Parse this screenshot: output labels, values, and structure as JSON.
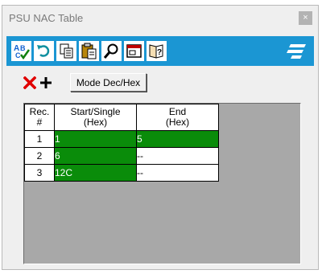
{
  "window": {
    "title": "PSU NAC Table",
    "close_glyph": "×"
  },
  "toolbar": {
    "buttons": [
      {
        "name": "spellcheck-icon"
      },
      {
        "name": "undo-icon"
      },
      {
        "name": "copy-icon"
      },
      {
        "name": "paste-icon"
      },
      {
        "name": "search-icon"
      },
      {
        "name": "window-icon"
      },
      {
        "name": "help-icon"
      }
    ],
    "logo": "app-logo-icon"
  },
  "edit": {
    "delete_icon": "delete-icon",
    "add_icon": "add-icon",
    "mode_label": "Mode Dec/Hex"
  },
  "table": {
    "headers": {
      "rec_line1": "Rec.",
      "rec_line2": "#",
      "start_line1": "Start/Single",
      "start_line2": "(Hex)",
      "end_line1": "End",
      "end_line2": "(Hex)"
    },
    "rows": [
      {
        "rec": "1",
        "start": "1",
        "end": "5"
      },
      {
        "rec": "2",
        "start": "6",
        "end": "--"
      },
      {
        "rec": "3",
        "start": "12C",
        "end": "--"
      }
    ]
  },
  "colors": {
    "toolbar": "#1b96d3",
    "selected_cell": "#0a8c0a",
    "grid_background": "#a8a8a8"
  }
}
